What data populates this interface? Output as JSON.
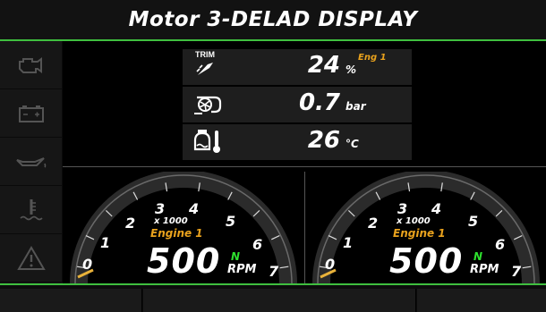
{
  "header": {
    "title": "Motor 3-DELAD DISPLAY"
  },
  "sidebar": {
    "icons": [
      "engine-warning-icon",
      "battery-icon",
      "oil-pressure-icon",
      "coolant-temp-icon",
      "warning-triangle-icon"
    ]
  },
  "readouts": {
    "trim": {
      "label": "TRIM",
      "value": "24",
      "unit": "%",
      "engine": "Eng 1",
      "icon": "trim-icon"
    },
    "boost": {
      "value": "0.7",
      "unit": "bar",
      "icon": "turbo-icon"
    },
    "temp": {
      "value": "26",
      "unit": "°C",
      "icon": "engine-temp-icon"
    }
  },
  "gauges": [
    {
      "ticks": [
        "0",
        "1",
        "2",
        "3",
        "4",
        "5",
        "6",
        "7"
      ],
      "multiplier": "x 1000",
      "engine": "Engine 1",
      "rpm": "500",
      "gear": "N",
      "unit": "RPM"
    },
    {
      "ticks": [
        "0",
        "1",
        "2",
        "3",
        "4",
        "5",
        "6",
        "7"
      ],
      "multiplier": "x 1000",
      "engine": "Engine 1",
      "rpm": "500",
      "gear": "N",
      "unit": "RPM"
    }
  ],
  "colors": {
    "accent": "#3fbf3f",
    "engine_label": "#e9a21d",
    "gear": "#2ee02e",
    "needle": "#e9b23a"
  }
}
